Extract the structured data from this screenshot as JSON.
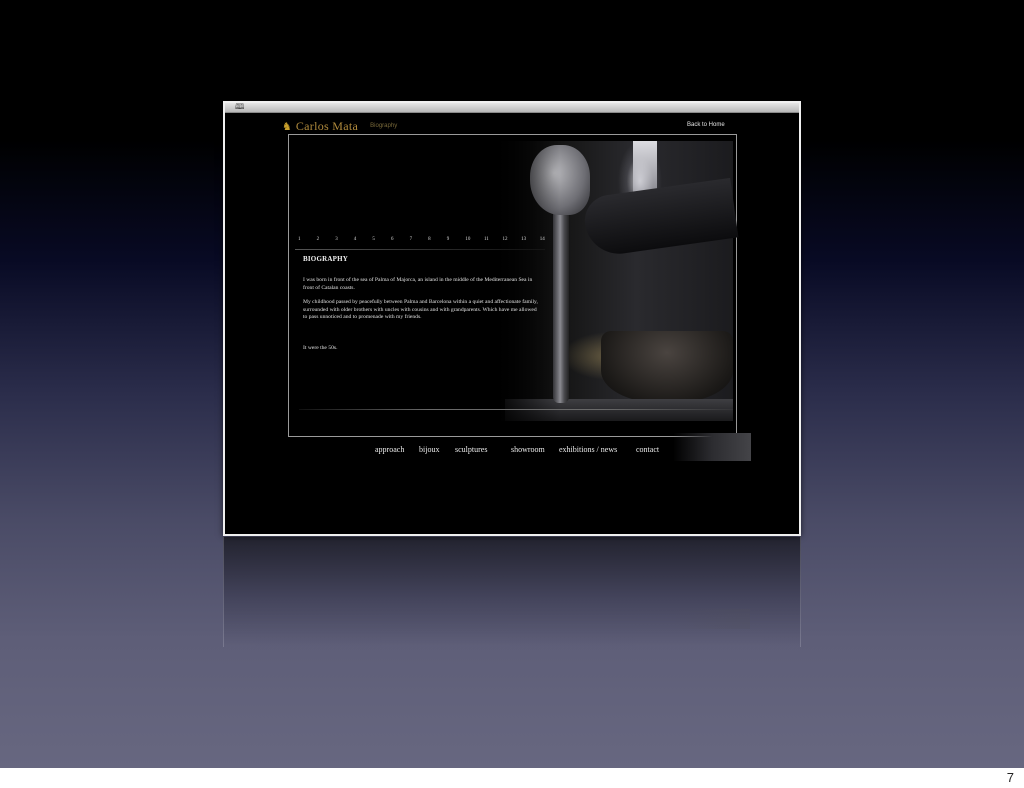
{
  "slide": {
    "page_number": "7"
  },
  "window": {
    "titlebar_icon": "book-icon"
  },
  "site": {
    "logo_icon": "horse-icon",
    "logo_text": "Carlos Mata",
    "section_label": "Biography",
    "back_link": "Back to Home"
  },
  "pagination": [
    "1",
    "2",
    "3",
    "4",
    "5",
    "6",
    "7",
    "8",
    "9",
    "10",
    "11",
    "12",
    "13",
    "14"
  ],
  "biography": {
    "heading": "BIOGRAPHY",
    "paragraph_1": "I was born in front of the sea of Palma of Majorca, an island in the middle of the Mediterranean Sea in front of Catalan coasts.",
    "paragraph_2": "My childhood passed by peacefully between Palma and Barcelona within a quiet and affectionate family, surrounded with older brothers with uncles with cousins and with grandparents. Which have me allowed to pass unnoticed and to promenade with my friends.",
    "paragraph_3": "It were the 50s."
  },
  "nav": {
    "approach": "approach",
    "bijoux": "bijoux",
    "sculptures": "sculptures",
    "showroom": "showroom",
    "exhibitions": "exhibitions / news",
    "contact": "contact"
  },
  "colors": {
    "logo_gold": "#b08a3c",
    "page_background": "#000000"
  }
}
